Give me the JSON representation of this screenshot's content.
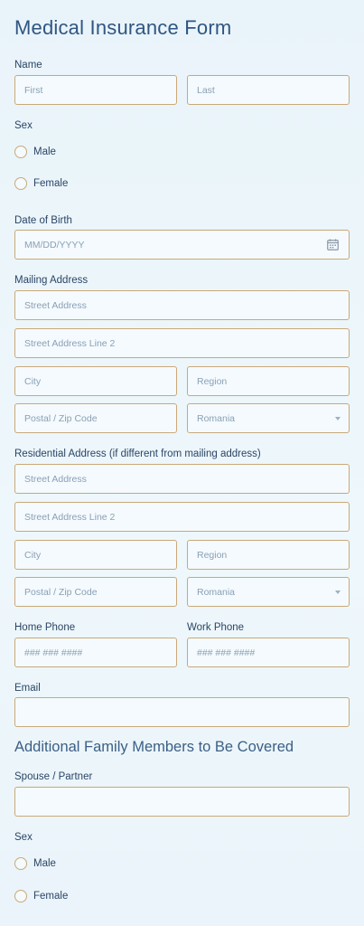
{
  "form": {
    "title": "Medical Insurance Form",
    "name": {
      "label": "Name",
      "first_placeholder": "First",
      "last_placeholder": "Last"
    },
    "sex": {
      "label": "Sex",
      "options": [
        "Male",
        "Female"
      ]
    },
    "dob": {
      "label": "Date of Birth",
      "placeholder": "MM/DD/YYYY",
      "icon": "calendar-icon"
    },
    "mailing": {
      "label": "Mailing Address",
      "street": "Street Address",
      "street2": "Street Address Line 2",
      "city": "City",
      "region": "Region",
      "postal": "Postal / Zip Code",
      "country": "Romania"
    },
    "residential": {
      "label": "Residential Address (if different from mailing address)",
      "street": "Street Address",
      "street2": "Street Address Line 2",
      "city": "City",
      "region": "Region",
      "postal": "Postal / Zip Code",
      "country": "Romania"
    },
    "home_phone": {
      "label": "Home Phone",
      "placeholder": "### ### ####"
    },
    "work_phone": {
      "label": "Work Phone",
      "placeholder": "### ### ####"
    },
    "email": {
      "label": "Email",
      "value": ""
    }
  },
  "family": {
    "title": "Additional Family Members to Be Covered",
    "spouse": {
      "label": "Spouse / Partner",
      "value": ""
    },
    "sex": {
      "label": "Sex",
      "options": [
        "Male",
        "Female"
      ]
    }
  },
  "colors": {
    "background": "#eaf4fa",
    "border": "#c9a978",
    "title": "#2f5582",
    "text": "#2a4566",
    "placeholder": "#8aa0b6"
  }
}
